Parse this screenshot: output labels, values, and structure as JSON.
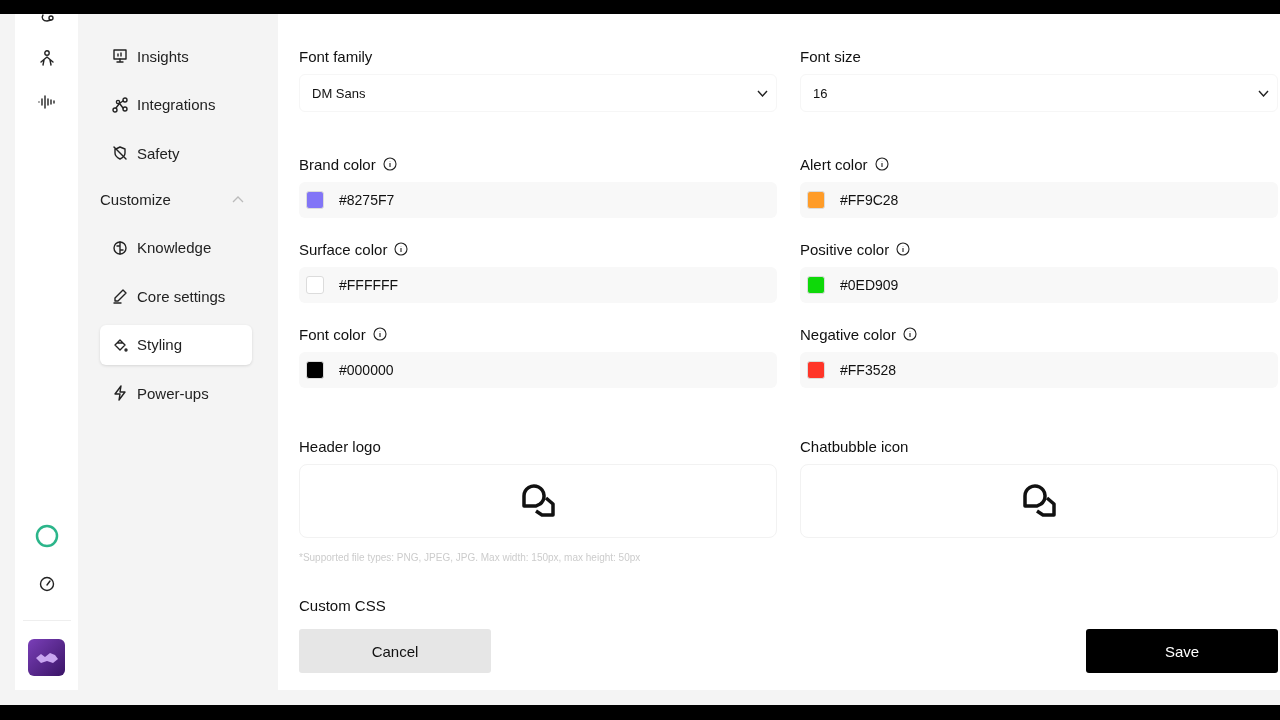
{
  "sidebar": {
    "items": [
      {
        "kind": "item",
        "label": "Insights",
        "selected": false
      },
      {
        "kind": "item",
        "label": "Integrations",
        "selected": false
      },
      {
        "kind": "item",
        "label": "Safety",
        "selected": false
      },
      {
        "kind": "section",
        "label": "Customize",
        "expanded": true
      },
      {
        "kind": "item",
        "label": "Knowledge",
        "selected": false
      },
      {
        "kind": "item",
        "label": "Core settings",
        "selected": false
      },
      {
        "kind": "item",
        "label": "Styling",
        "selected": true
      },
      {
        "kind": "item",
        "label": "Power-ups",
        "selected": false
      }
    ]
  },
  "form": {
    "selects": [
      {
        "label": "Font family",
        "value": "DM Sans"
      },
      {
        "label": "Font size",
        "value": "16"
      }
    ],
    "colors": [
      {
        "label": "Brand color",
        "value": "#8275F7",
        "color": "#8275f7"
      },
      {
        "label": "Alert color",
        "value": "#FF9C28",
        "color": "#ff9c28"
      },
      {
        "label": "Surface color",
        "value": "#FFFFFF",
        "color": "#ffffff"
      },
      {
        "label": "Positive color",
        "value": "#0ED909",
        "color": "#0ed909"
      },
      {
        "label": "Font color",
        "value": "#000000",
        "color": "#000000"
      },
      {
        "label": "Negative color",
        "value": "#FF3528",
        "color": "#ff3528"
      }
    ],
    "uploads": [
      {
        "label": "Header logo"
      },
      {
        "label": "Chatbubble icon"
      }
    ],
    "upload_note": "*Supported file types: PNG, JPEG, JPG. Max width: 150px, max height: 50px",
    "custom_css_label": "Custom CSS",
    "buttons": [
      {
        "kind": "secondary",
        "label": "Cancel"
      },
      {
        "kind": "primary",
        "label": "Save"
      }
    ]
  }
}
